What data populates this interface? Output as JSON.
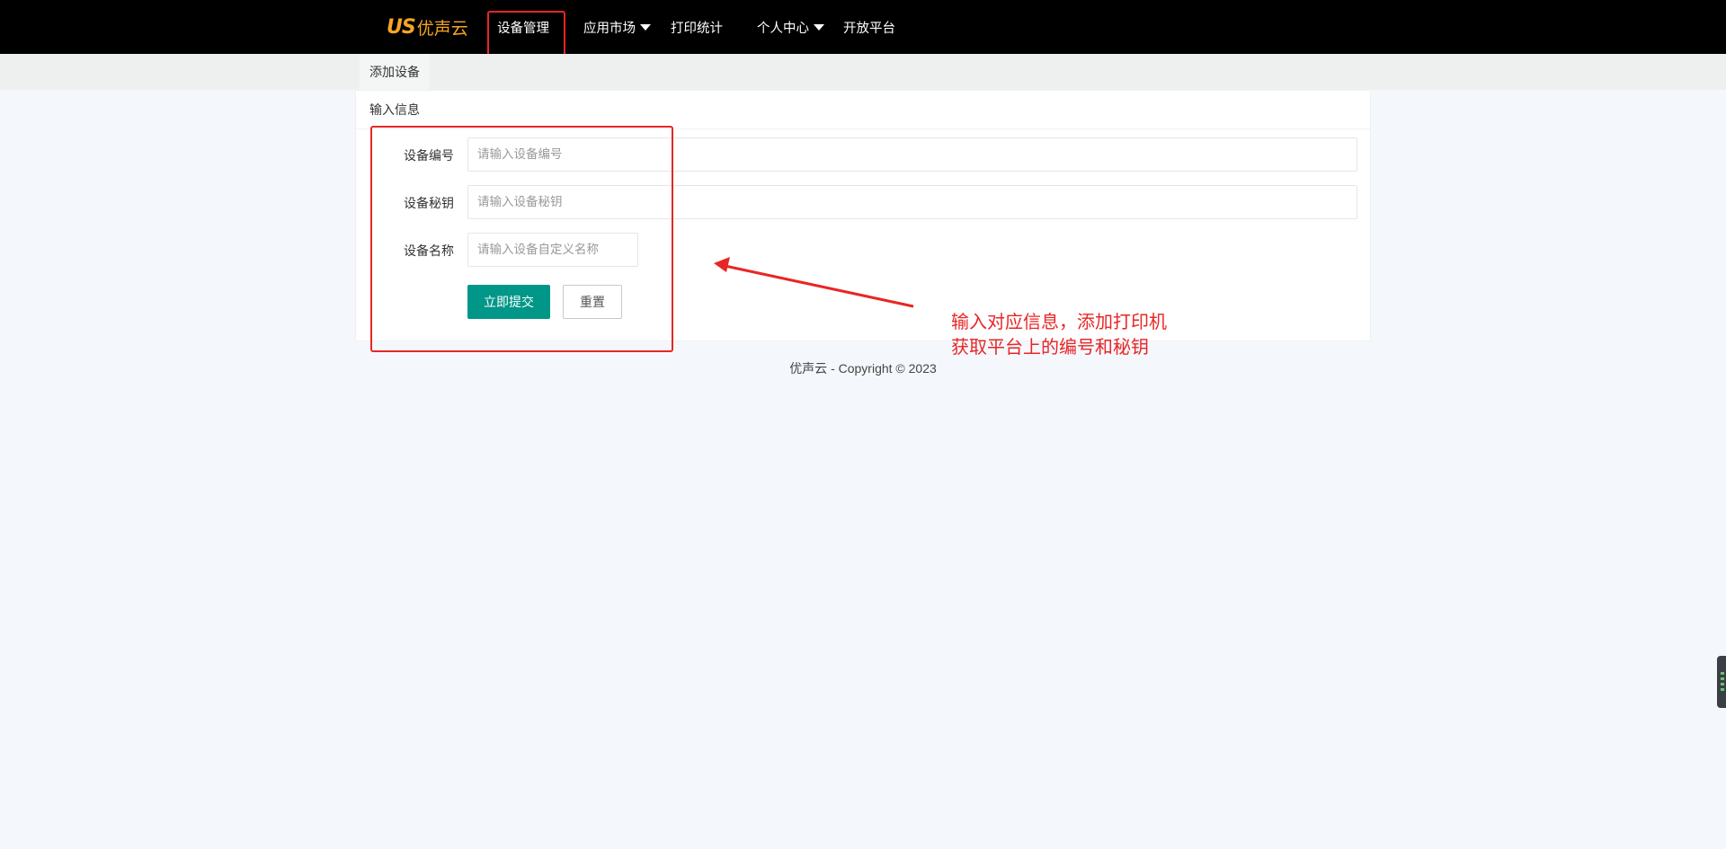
{
  "brand": {
    "logo_mark": "US",
    "name": "优声云",
    "accent_color": "#f5a623"
  },
  "nav": {
    "items": [
      {
        "label": "设备管理",
        "has_dropdown": false,
        "active": true
      },
      {
        "label": "应用市场",
        "has_dropdown": true
      },
      {
        "label": "打印统计",
        "has_dropdown": false
      },
      {
        "label": "个人中心",
        "has_dropdown": true
      },
      {
        "label": "开放平台",
        "has_dropdown": false
      }
    ]
  },
  "subnav": {
    "tab": "添加设备"
  },
  "card": {
    "title": "输入信息",
    "fields": [
      {
        "label": "设备编号",
        "placeholder": "请输入设备编号",
        "value": ""
      },
      {
        "label": "设备秘钥",
        "placeholder": "请输入设备秘钥",
        "value": ""
      },
      {
        "label": "设备名称",
        "placeholder": "请输入设备自定义名称",
        "value": ""
      }
    ],
    "submit_label": "立即提交",
    "reset_label": "重置",
    "submit_color": "#009688"
  },
  "footer": {
    "text": "优声云 - Copyright © 2023"
  },
  "annotation": {
    "line1": "输入对应信息，添加打印机",
    "line2": "获取平台上的编号和秘钥",
    "color": "#e82626"
  }
}
